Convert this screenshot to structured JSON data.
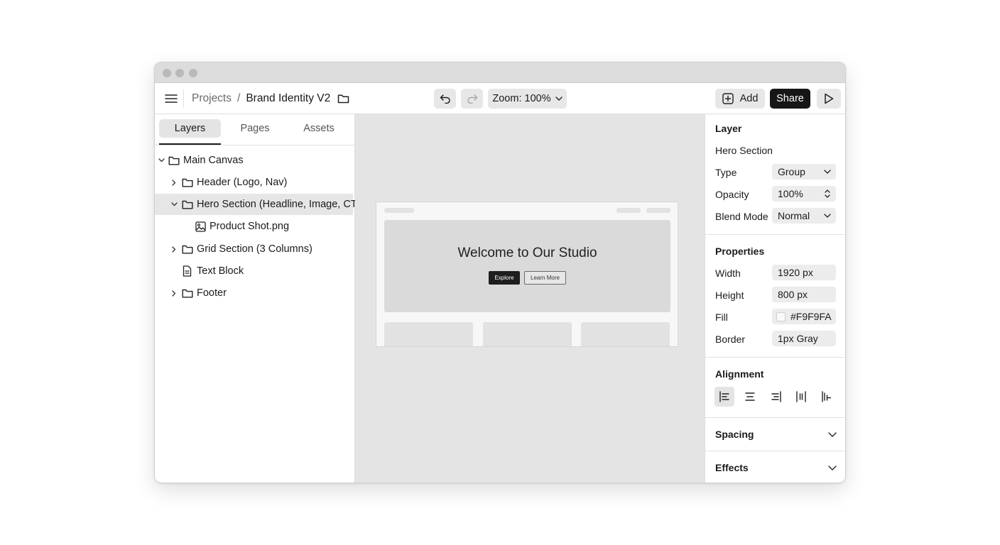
{
  "window": {
    "colors": {
      "share_bg": "#161616",
      "selected_row": "#e6e6e6",
      "canvas_bg": "#e4e4e4"
    }
  },
  "toolbar": {
    "menu_icon": "hamburger-menu-icon",
    "breadcrumb": {
      "parent": "Projects",
      "separator": "/",
      "current": "Brand Identity V2"
    },
    "zoom_label": "Zoom: 100%",
    "add_label": "Add",
    "share_label": "Share"
  },
  "left_panel": {
    "tabs": [
      {
        "label": "Layers",
        "active": true
      },
      {
        "label": "Pages",
        "active": false
      },
      {
        "label": "Assets",
        "active": false
      }
    ],
    "tree": [
      {
        "label": "Main Canvas",
        "icon": "folder-icon",
        "expanded": true,
        "depth": 0
      },
      {
        "label": "Header (Logo, Nav)",
        "icon": "folder-icon",
        "expanded": false,
        "depth": 1
      },
      {
        "label": "Hero Section (Headline, Image, CTA)",
        "icon": "folder-icon",
        "expanded": true,
        "depth": 1,
        "selected": true
      },
      {
        "label": "Product Shot.png",
        "icon": "image-icon",
        "depth": 2
      },
      {
        "label": "Grid Section (3 Columns)",
        "icon": "folder-icon",
        "expanded": false,
        "depth": 1
      },
      {
        "label": "Text Block",
        "icon": "document-icon",
        "depth": 1
      },
      {
        "label": "Footer",
        "icon": "folder-icon",
        "expanded": false,
        "depth": 1
      }
    ]
  },
  "canvas": {
    "headline": "Welcome to Our Studio",
    "primary_cta": "Explore",
    "secondary_cta": "Learn More"
  },
  "right_panel": {
    "layer": {
      "title": "Layer",
      "name": "Hero Section",
      "type_label": "Type",
      "type_value": "Group",
      "opacity_label": "Opacity",
      "opacity_value": "100%",
      "blend_label": "Blend Mode",
      "blend_value": "Normal"
    },
    "properties": {
      "title": "Properties",
      "width_label": "Width",
      "width_value": "1920 px",
      "height_label": "Height",
      "height_value": "800 px",
      "fill_label": "Fill",
      "fill_value": "#F9F9FA",
      "border_label": "Border",
      "border_value": "1px Gray"
    },
    "alignment": {
      "title": "Alignment",
      "buttons": [
        "align-left-icon",
        "align-center-icon",
        "align-right-icon",
        "distribute-horizontal-icon",
        "align-top-icon"
      ]
    },
    "spacing_title": "Spacing",
    "effects_title": "Effects"
  }
}
